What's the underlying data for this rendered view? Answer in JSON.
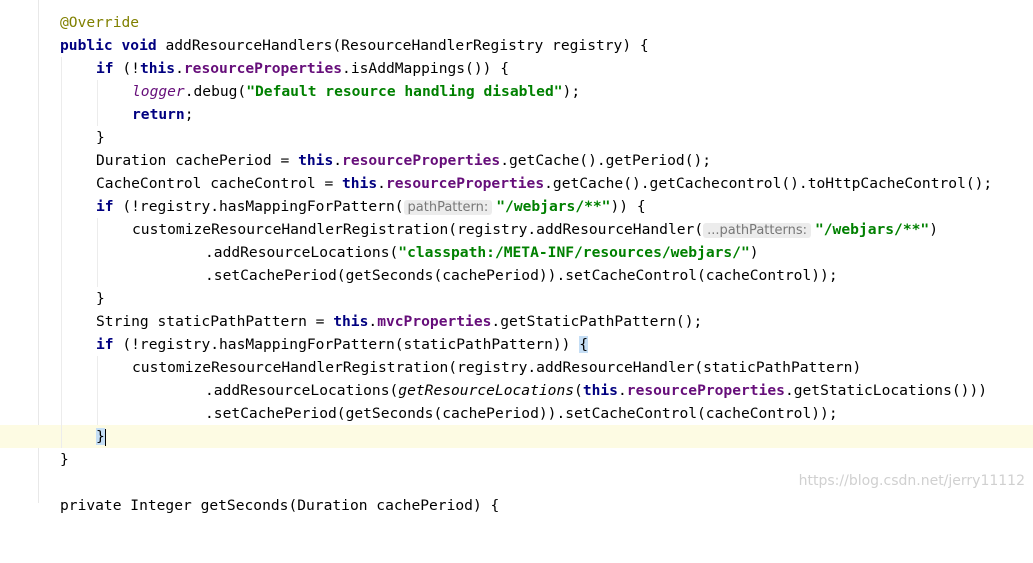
{
  "editor": {
    "code": {
      "l1_annotation": "@Override",
      "l2_public": "public",
      "l2_void": "void",
      "l2_signature": " addResourceHandlers(ResourceHandlerRegistry registry) {",
      "l3_if": "if",
      "l3_open": " (!",
      "l3_this": "this",
      "l3_dot": ".",
      "l3_field": "resourceProperties",
      "l3_rest": ".isAddMappings()) {",
      "l4_logger": "logger",
      "l4_call": ".debug(",
      "l4_string": "\"Default resource handling disabled\"",
      "l4_close": ");",
      "l5_return": "return",
      "l5_semicolon": ";",
      "l6_brace": "}",
      "l7_decl": "Duration cachePeriod = ",
      "l7_this": "this",
      "l7_dot": ".",
      "l7_field": "resourceProperties",
      "l7_rest": ".getCache().getPeriod();",
      "l8_decl": "CacheControl cacheControl = ",
      "l8_this": "this",
      "l8_dot": ".",
      "l8_field": "resourceProperties",
      "l8_rest": ".getCache().getCachecontrol().toHttpCacheControl();",
      "l9_if": "if",
      "l9_call": " (!registry.hasMappingForPattern(",
      "l9_hint": "pathPattern:",
      "l9_string": "\"/webjars/**\"",
      "l9_close": ")) {",
      "l10_call": "customizeResourceHandlerRegistration(registry.addResourceHandler(",
      "l10_hint": "...pathPatterns:",
      "l10_string": "\"/webjars/**\"",
      "l10_close": ")",
      "l11_call": ".addResourceLocations(",
      "l11_string": "\"classpath:/META-INF/resources/webjars/\"",
      "l11_close": ")",
      "l12_call": ".setCachePeriod(getSeconds(cachePeriod)).setCacheControl(cacheControl));",
      "l13_brace": "}",
      "l14_decl": "String staticPathPattern = ",
      "l14_this": "this",
      "l14_dot": ".",
      "l14_field": "mvcProperties",
      "l14_rest": ".getStaticPathPattern();",
      "l15_if": "if",
      "l15_call": " (!registry.hasMappingForPattern(staticPathPattern)) ",
      "l15_brace": "{",
      "l16_call": "customizeResourceHandlerRegistration(registry.addResourceHandler(staticPathPattern)",
      "l17_call": ".addResourceLocations(",
      "l17_static": "getResourceLocations",
      "l17_open": "(",
      "l17_this": "this",
      "l17_dot": ".",
      "l17_field": "resourceProperties",
      "l17_rest": ".getStaticLocations()))",
      "l18_call": ".setCachePeriod(getSeconds(cachePeriod)).setCacheControl(cacheControl));",
      "l19_brace": "}",
      "l20_brace": "}",
      "l22_partial": "private Integer getSeconds(Duration cachePeriod) {"
    }
  },
  "colors": {
    "keyword": "#000080",
    "field": "#660e7a",
    "string": "#008000",
    "annotation": "#808000",
    "current_line": "#fdfbe3",
    "brace_match": "#c5def5"
  },
  "watermark": "https://blog.csdn.net/jerry11112"
}
